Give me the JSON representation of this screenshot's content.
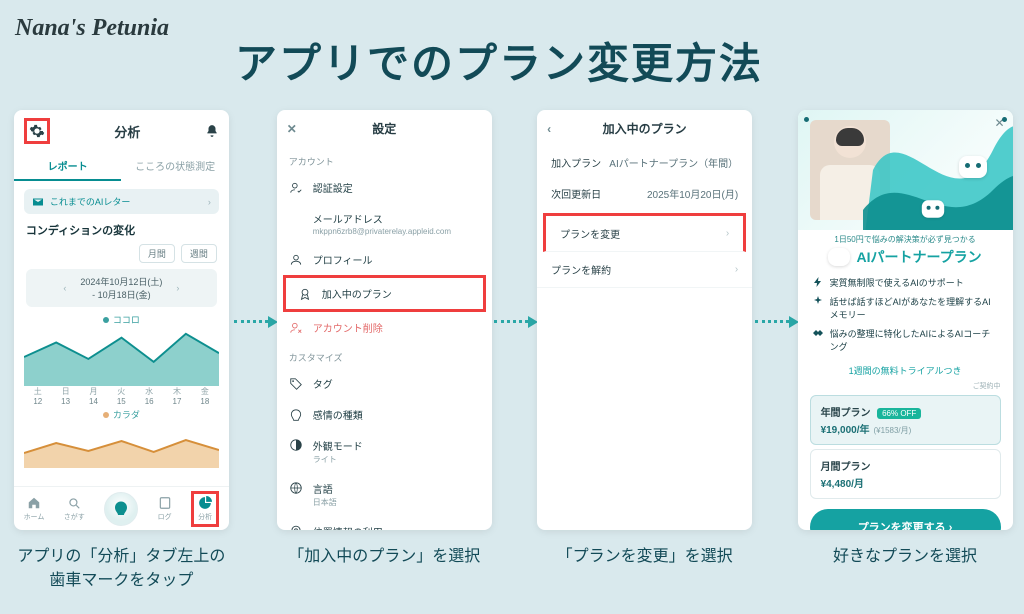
{
  "brand": "Nana's Petunia",
  "page_title": "アプリでのプラン変更方法",
  "captions": {
    "step1": "アプリの「分析」タブ左上の歯車マークをタップ",
    "step2": "「加入中のプラン」を選択",
    "step3": "「プランを変更」を選択",
    "step4": "好きなプランを選択"
  },
  "screen1": {
    "title": "分析",
    "tabs": {
      "reports": "レポート",
      "state": "こころの状態測定"
    },
    "ai_letter": "これまでのAIレター",
    "condition_title": "コンディションの変化",
    "range": {
      "month": "月間",
      "week": "週間"
    },
    "date_range": {
      "from": "2024年10月12日(土)",
      "to": "- 10月18日(金)"
    },
    "legend": {
      "mind": "ココロ",
      "body": "カラダ"
    },
    "axis": [
      {
        "d": "土",
        "n": "12"
      },
      {
        "d": "日",
        "n": "13"
      },
      {
        "d": "月",
        "n": "14"
      },
      {
        "d": "火",
        "n": "15"
      },
      {
        "d": "水",
        "n": "16"
      },
      {
        "d": "木",
        "n": "17"
      },
      {
        "d": "金",
        "n": "18"
      }
    ],
    "tabbar": {
      "home": "ホーム",
      "explore": "さがす",
      "ai": "AI",
      "log": "ログ",
      "analytics": "分析"
    }
  },
  "screen2": {
    "title": "設定",
    "group_account": "アカウント",
    "rows": {
      "auth": "認証設定",
      "email_label": "メールアドレス",
      "email_value": "mkppn6zrb8@privaterelay.appleid.com",
      "profile": "プロフィール",
      "plan": "加入中のプラン",
      "delete": "アカウント削除"
    },
    "group_customize": "カスタマイズ",
    "rows2": {
      "tags": "タグ",
      "emotions": "感情の種類",
      "appearance_label": "外観モード",
      "appearance_value": "ライト",
      "lang_label": "言語",
      "lang_value": "日本語",
      "location": "位置情報の利用"
    }
  },
  "screen3": {
    "title": "加入中のプラン",
    "kv": {
      "plan_label": "加入プラン",
      "plan_value": "AIパートナープラン（年間）",
      "renew_label": "次回更新日",
      "renew_value": "2025年10月20日(月)"
    },
    "rows": {
      "change": "プランを変更",
      "cancel": "プランを解約"
    }
  },
  "screen4": {
    "tagline": "1日50円で悩みの解決策が必ず見つかる",
    "plan_title": "AIパートナープラン",
    "features": [
      "実質無制限で使えるAIのサポート",
      "話せば話すほどAIがあなたを理解するAIメモリー",
      "悩みの整理に特化したAIによるAIコーチング"
    ],
    "trial": "1週間の無料トライアルつき",
    "terms": "ご契約中",
    "yearly": {
      "name": "年間プラン",
      "badge": "66% OFF",
      "price": "¥19,000/年",
      "sub": "(¥1583/月)"
    },
    "monthly": {
      "name": "月間プラン",
      "price": "¥4,480/月"
    },
    "cta": "プランを変更する"
  },
  "chart_data": [
    {
      "type": "area",
      "series_name": "ココロ",
      "categories": [
        "土12",
        "日13",
        "月14",
        "火15",
        "水16",
        "木17",
        "金18"
      ],
      "values": [
        55,
        75,
        50,
        85,
        45,
        90,
        60
      ],
      "ylim": [
        0,
        100
      ]
    },
    {
      "type": "area",
      "series_name": "カラダ",
      "categories": [
        "土12",
        "日13",
        "月14",
        "火15",
        "水16",
        "木17",
        "金18"
      ],
      "values": [
        35,
        55,
        40,
        60,
        38,
        62,
        42
      ],
      "ylim": [
        0,
        100
      ]
    }
  ]
}
